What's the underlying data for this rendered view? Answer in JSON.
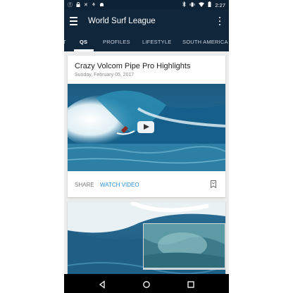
{
  "status_bar": {
    "time": "2:27",
    "left_icons": [
      "facebook-icon",
      "lock-icon",
      "tools-icon",
      "surf-icon",
      "android-icon"
    ],
    "right_icons": [
      "bluetooth-icon",
      "vibrate-icon",
      "wifi-icon",
      "battery-icon"
    ]
  },
  "app_bar": {
    "title": "World Surf League"
  },
  "tabs": [
    {
      "label": "T",
      "active": false
    },
    {
      "label": "QS",
      "active": true
    },
    {
      "label": "PROFILES",
      "active": false
    },
    {
      "label": "LIFESTYLE",
      "active": false
    },
    {
      "label": "SOUTH AMERICA",
      "active": false
    }
  ],
  "cards": [
    {
      "title": "Crazy Volcom Pipe Pro Highlights",
      "date": "Sunday, February 05, 2017",
      "share_label": "SHARE",
      "watch_label": "WATCH VIDEO"
    }
  ],
  "colors": {
    "app_bar": "#10263b",
    "status_bar": "#0e2236",
    "accent": "#2a8fd6",
    "background": "#ececec"
  }
}
